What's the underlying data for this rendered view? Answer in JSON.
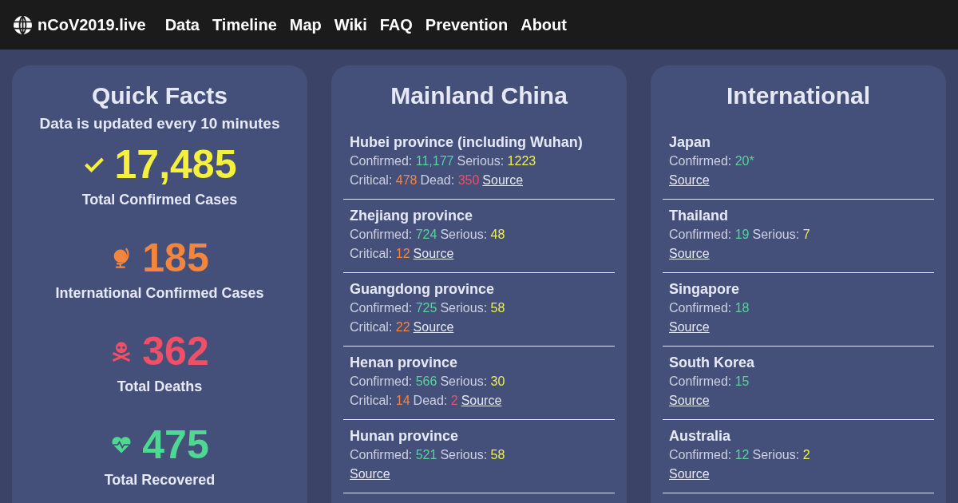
{
  "nav": {
    "brand": "nCoV2019.live",
    "links": [
      "Data",
      "Timeline",
      "Map",
      "Wiki",
      "FAQ",
      "Prevention",
      "About"
    ]
  },
  "quick_facts": {
    "title": "Quick Facts",
    "subtitle": "Data is updated every 10 minutes",
    "facts": [
      {
        "kind": "confirmed",
        "value": "17,485",
        "label": "Total Confirmed Cases"
      },
      {
        "kind": "international",
        "value": "185",
        "label": "International Confirmed Cases"
      },
      {
        "kind": "deaths",
        "value": "362",
        "label": "Total Deaths"
      },
      {
        "kind": "recovered",
        "value": "475",
        "label": "Total Recovered"
      }
    ]
  },
  "panels": [
    {
      "title": "Mainland China",
      "regions": [
        {
          "name": "Hubei province (including Wuhan)",
          "lines": [
            [
              {
                "kind": "confirmed",
                "label": "Confirmed:",
                "value": "11,177"
              },
              {
                "kind": "serious",
                "label": "Serious:",
                "value": "1223"
              }
            ],
            [
              {
                "kind": "critical",
                "label": "Critical:",
                "value": "478"
              },
              {
                "kind": "dead",
                "label": "Dead:",
                "value": "350"
              },
              {
                "kind": "source",
                "label": "Source"
              }
            ]
          ]
        },
        {
          "name": "Zhejiang province",
          "lines": [
            [
              {
                "kind": "confirmed",
                "label": "Confirmed:",
                "value": "724"
              },
              {
                "kind": "serious",
                "label": "Serious:",
                "value": "48"
              }
            ],
            [
              {
                "kind": "critical",
                "label": "Critical:",
                "value": "12"
              },
              {
                "kind": "source",
                "label": "Source"
              }
            ]
          ]
        },
        {
          "name": "Guangdong province",
          "lines": [
            [
              {
                "kind": "confirmed",
                "label": "Confirmed:",
                "value": "725"
              },
              {
                "kind": "serious",
                "label": "Serious:",
                "value": "58"
              }
            ],
            [
              {
                "kind": "critical",
                "label": "Critical:",
                "value": "22"
              },
              {
                "kind": "source",
                "label": "Source"
              }
            ]
          ]
        },
        {
          "name": "Henan province",
          "lines": [
            [
              {
                "kind": "confirmed",
                "label": "Confirmed:",
                "value": "566"
              },
              {
                "kind": "serious",
                "label": "Serious:",
                "value": "30"
              }
            ],
            [
              {
                "kind": "critical",
                "label": "Critical:",
                "value": "14"
              },
              {
                "kind": "dead",
                "label": "Dead:",
                "value": "2"
              },
              {
                "kind": "source",
                "label": "Source"
              }
            ]
          ]
        },
        {
          "name": "Hunan province",
          "lines": [
            [
              {
                "kind": "confirmed",
                "label": "Confirmed:",
                "value": "521"
              },
              {
                "kind": "serious",
                "label": "Serious:",
                "value": "58"
              }
            ],
            [
              {
                "kind": "source",
                "label": "Source"
              }
            ]
          ]
        }
      ]
    },
    {
      "title": "International",
      "regions": [
        {
          "name": "Japan",
          "lines": [
            [
              {
                "kind": "confirmed",
                "label": "Confirmed:",
                "value": "20*"
              }
            ],
            [
              {
                "kind": "source",
                "label": "Source"
              }
            ]
          ]
        },
        {
          "name": "Thailand",
          "lines": [
            [
              {
                "kind": "confirmed",
                "label": "Confirmed:",
                "value": "19"
              },
              {
                "kind": "serious",
                "label": "Serious:",
                "value": "7"
              }
            ],
            [
              {
                "kind": "source",
                "label": "Source"
              }
            ]
          ]
        },
        {
          "name": "Singapore",
          "lines": [
            [
              {
                "kind": "confirmed",
                "label": "Confirmed:",
                "value": "18"
              }
            ],
            [
              {
                "kind": "source",
                "label": "Source"
              }
            ]
          ]
        },
        {
          "name": "South Korea",
          "lines": [
            [
              {
                "kind": "confirmed",
                "label": "Confirmed:",
                "value": "15"
              }
            ],
            [
              {
                "kind": "source",
                "label": "Source"
              }
            ]
          ]
        },
        {
          "name": "Australia",
          "lines": [
            [
              {
                "kind": "confirmed",
                "label": "Confirmed:",
                "value": "12"
              },
              {
                "kind": "serious",
                "label": "Serious:",
                "value": "2"
              }
            ],
            [
              {
                "kind": "source",
                "label": "Source"
              }
            ]
          ]
        }
      ]
    }
  ]
}
